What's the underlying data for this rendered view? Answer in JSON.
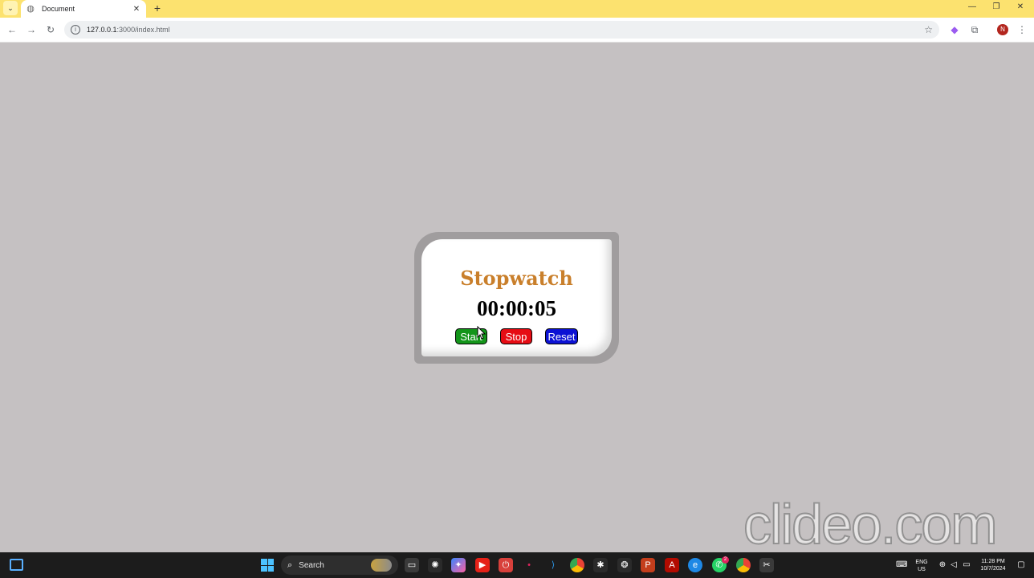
{
  "browser": {
    "tab_title": "Document",
    "url_host": "127.0.0.1",
    "url_path": ":3000/index.html"
  },
  "stopwatch": {
    "title": "Stopwatch",
    "time": "00:00:05",
    "buttons": {
      "start": "Start",
      "stop": "Stop",
      "reset": "Reset"
    },
    "colors": {
      "title": "#c97f2b",
      "start": "#13951a",
      "stop": "#e60c14",
      "reset": "#0c12d4"
    }
  },
  "watermark": "clideo.com",
  "taskbar": {
    "search_label": "Search",
    "language": "ENG",
    "region": "US",
    "time": "11:28 PM",
    "date": "10/7/2024",
    "whatsapp_badge": "2",
    "profile_initial": "N"
  }
}
